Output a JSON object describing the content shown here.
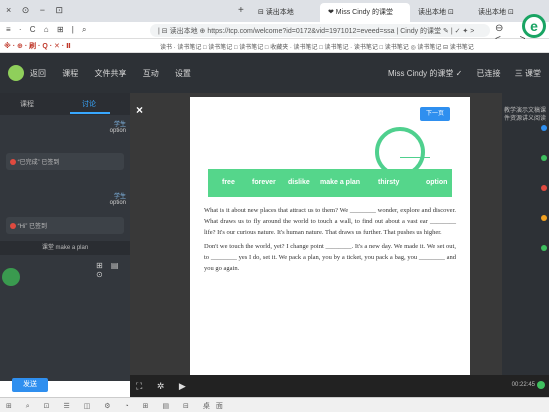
{
  "browser": {
    "window_controls": "×  ⊙  −  ⊡",
    "tabs": [
      {
        "label": "⊟ 读出本地",
        "active": false
      },
      {
        "label": "❤ Miss Cindy 的课堂",
        "active": true
      },
      {
        "label": "读出本地 ⊡",
        "active": false
      },
      {
        "label": "读出本地 ⊡",
        "active": false
      }
    ],
    "new_tab": "+",
    "left_cluster": "≡ · C ⌂ ⊞ | ⌕",
    "url": "| ⊟ 读出本地 ⊕ https://tcp.com/welcome?id=0172&vid=1971012=eveed=ssa | Cindy 的课堂 ✎ | ✓ ✦ >",
    "nav_buttons": "⊖ ⊘ < >",
    "extension_logo": "e",
    "bookmarks_left": "※ · ⊕ · 刷 · Q · ✕ · Ⅱ",
    "bookmarks": "读书 · 读书笔记 □ 读书笔记 □ 读书笔记 □ 收藏夹 · 读书笔记 □ 读书笔记 · 读书笔记 □ 读书笔记 ◎ 读书笔记 ⊟ 读书笔记"
  },
  "app": {
    "menu": [
      "返回",
      "课程",
      "文件共享",
      "互动",
      "设置"
    ],
    "user": [
      "Miss Cindy 的课堂 ✓",
      "已连接",
      "三 课堂"
    ],
    "left_tabs": [
      "课程",
      "讨论"
    ],
    "chat": [
      {
        "meta": "学生",
        "sub": "option"
      },
      {
        "bubble": "“已完成” 已签到"
      },
      {
        "meta": "学生",
        "sub": "option"
      },
      {
        "bubble": "“Hi” 已签到"
      }
    ],
    "room_title": "课堂 make a plan",
    "left_icons": "⊞ ▤ ⊙",
    "send_label": "发送",
    "right_panel_text": "教学演示文稿课件资源讲义阅读"
  },
  "overlay": {
    "close": "×",
    "card_button": "下一页",
    "word_bank": [
      "option",
      "thirsty",
      "make a plan",
      "dislike",
      "forever",
      "free"
    ],
    "passage": [
      "What is it about new places that attract us to them? We ________ wonder, explore and discover. What draws us to fly around the world to touch a wall, to find out about a vast ear ________ life? It's our curious nature. It's human nature. That draws us further. That pushes us higher.",
      "Don't we touch the world, yet? I change point ________. It's a new day. We made it. We set out, to ________ yes I do, set it. We pack a plan, you by a ticket, you pack a bag, you ________ and you go again."
    ]
  },
  "controls": {
    "icons": "⛶ ✲ ▶",
    "timer": "00:22:45"
  },
  "taskbar": {
    "items": "⊞ ⌕ ⊡ ☰ ◫ ⚙ ◔ ⊞ ▤ ⊟ 桌面"
  },
  "colors": {
    "accent_green": "#55d68b",
    "accent_blue": "#2f8fef",
    "dark_bg": "#2d3136",
    "stage_bg": "#393939"
  }
}
